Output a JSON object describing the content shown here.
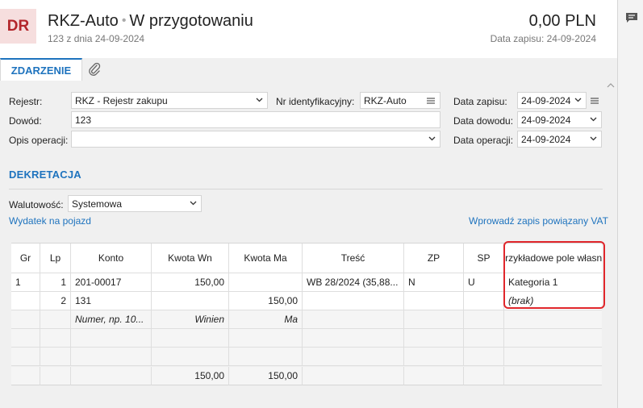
{
  "header": {
    "badge": "DR",
    "title": "RKZ-Auto",
    "status": "W przygotowaniu",
    "subtitle": "123 z dnia 24-09-2024",
    "amount": "0,00 PLN",
    "saved_label": "Data zapisu: 24-09-2024"
  },
  "tabs": {
    "active": "ZDARZENIE",
    "attach_icon": "paperclip-icon"
  },
  "form": {
    "rejestr_label": "Rejestr:",
    "rejestr_value": "RKZ - Rejestr zakupu",
    "nr_label": "Nr identyfikacyjny:",
    "nr_value": "RKZ-Auto",
    "data_zapisu_label": "Data zapisu:",
    "data_zapisu_value": "24-09-2024",
    "dowod_label": "Dowód:",
    "dowod_value": "123",
    "data_dowodu_label": "Data dowodu:",
    "data_dowodu_value": "24-09-2024",
    "opis_label": "Opis operacji:",
    "opis_value": "",
    "data_operacji_label": "Data operacji:",
    "data_operacji_value": "24-09-2024"
  },
  "dekretacja": {
    "title": "DEKRETACJA",
    "waluta_label": "Walutowość:",
    "waluta_value": "Systemowa",
    "link_left": "Wydatek na pojazd",
    "link_right": "Wprowadź zapis powiązany VAT"
  },
  "grid": {
    "headers": [
      "Gr",
      "Lp",
      "Konto",
      "Kwota Wn",
      "Kwota Ma",
      "Treść",
      "ZP",
      "SP",
      "Przykładowe pole własne"
    ],
    "rows": [
      {
        "gr": "1",
        "lp": "1",
        "konto": "201-00017",
        "wn": "150,00",
        "ma": "",
        "tresc": "WB 28/2024 (35,88...",
        "zp": "N",
        "sp": "U",
        "pole": "Kategoria 1"
      },
      {
        "gr": "",
        "lp": "2",
        "konto": "131",
        "wn": "",
        "ma": "150,00",
        "tresc": "",
        "zp": "",
        "sp": "",
        "pole": "(brak)"
      }
    ],
    "placeholders": {
      "konto": "Numer, np. 10...",
      "wn": "Winien",
      "ma": "Ma"
    },
    "totals": {
      "wn": "150,00",
      "ma": "150,00"
    }
  },
  "colors": {
    "accent": "#1e73be",
    "badge_bg": "#f6dede",
    "badge_text": "#b3262b",
    "highlight": "#e0262b"
  }
}
